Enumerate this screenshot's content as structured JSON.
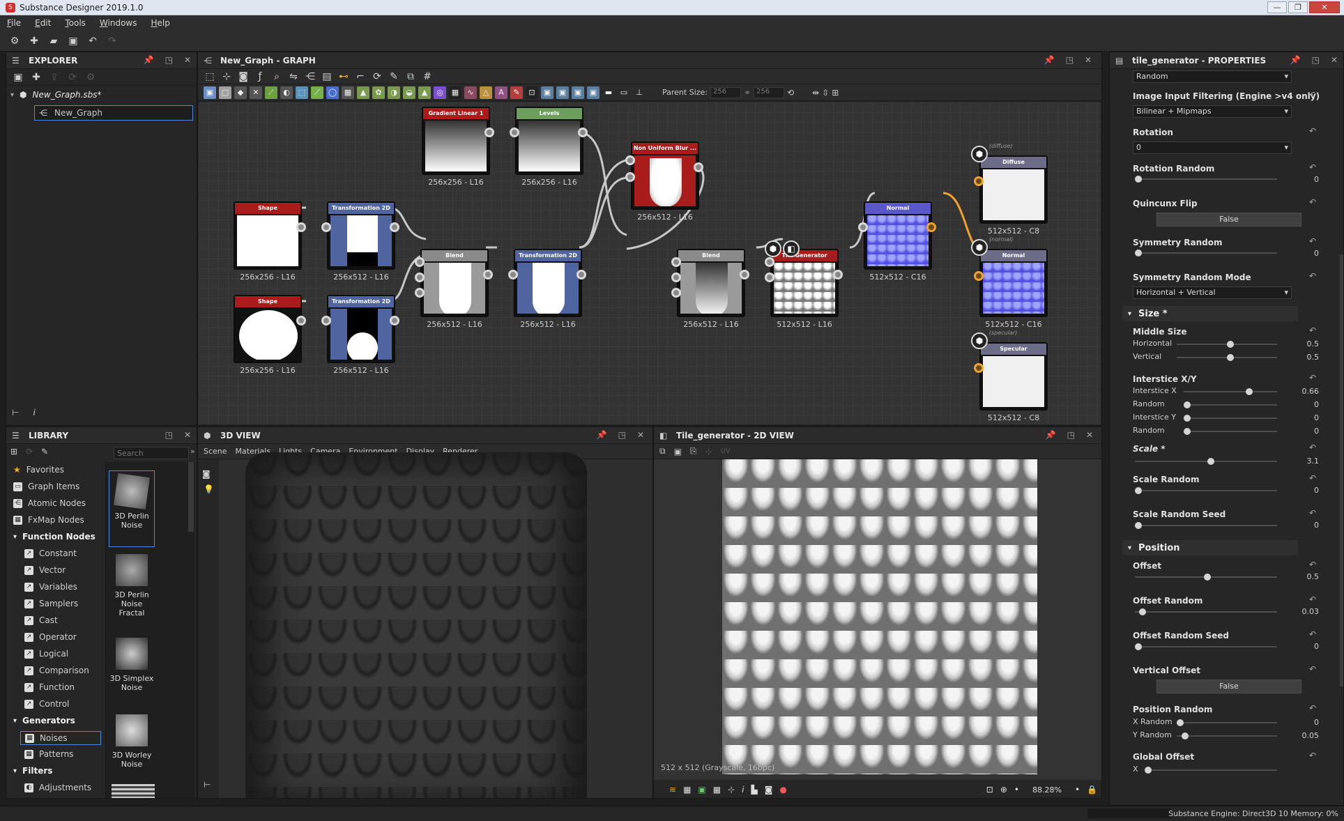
{
  "app": {
    "title": "Substance Designer 2019.1.0",
    "title_icon": "S"
  },
  "menu": [
    "File",
    "Edit",
    "Tools",
    "Windows",
    "Help"
  ],
  "explorer": {
    "title": "EXPLORER",
    "package": "New_Graph.sbs*",
    "graph": "New_Graph"
  },
  "graph_panel": {
    "title": "New_Graph - GRAPH",
    "parent_size_label": "Parent Size:",
    "parent_w": "256",
    "parent_h": "256"
  },
  "nodes": {
    "gradient": {
      "title": "Gradient Linear 1",
      "label": "256x256 - L16"
    },
    "levels": {
      "title": "Levels",
      "label": "256x256 - L16"
    },
    "nonuniform": {
      "title": "Non Uniform Blur ...",
      "label": "256x512 - L16"
    },
    "shape1": {
      "title": "Shape",
      "label": "256x256 - L16"
    },
    "transform1": {
      "title": "Transformation 2D",
      "label": "256x512 - L16"
    },
    "shape2": {
      "title": "Shape",
      "label": "256x256 - L16"
    },
    "transform2": {
      "title": "Transformation 2D",
      "label": "256x512 - L16"
    },
    "blend1": {
      "title": "Blend",
      "label": "256x512 - L16"
    },
    "transform3": {
      "title": "Transformation 2D",
      "label": "256x512 - L16"
    },
    "blend2": {
      "title": "Blend",
      "label": "256x512 - L16"
    },
    "tilegen": {
      "title": "Tile Generator",
      "label": "512x512 - L16"
    },
    "normal": {
      "title": "Normal",
      "label": "512x512 - C16"
    },
    "out_diffuse": {
      "title": "Diffuse",
      "tag": "(diffuse)",
      "label": "512x512 - C8"
    },
    "out_normal": {
      "title": "Normal",
      "tag": "(normal)",
      "label": "512x512 - C16"
    },
    "out_specular": {
      "title": "Specular",
      "tag": "(specular)",
      "label": "512x512 - C8"
    }
  },
  "library": {
    "title": "LIBRARY",
    "search_placeholder": "Search",
    "items": [
      "Favorites",
      "Graph Items",
      "Atomic Nodes",
      "FxMap Nodes"
    ],
    "function_header": "Function Nodes",
    "function_items": [
      "Constant",
      "Vector",
      "Variables",
      "Samplers",
      "Cast",
      "Operator",
      "Logical",
      "Comparison",
      "Function",
      "Control"
    ],
    "generators_header": "Generators",
    "generator_items": [
      "Noises",
      "Patterns"
    ],
    "filters_header": "Filters",
    "filter_items": [
      "Adjustments"
    ],
    "thumbs": [
      "3D Perlin Noise",
      "3D Perlin Noise Fractal",
      "3D Simplex Noise",
      "3D Worley Noise"
    ]
  },
  "view3d": {
    "title": "3D VIEW",
    "menu": [
      "Scene",
      "Materials",
      "Lights",
      "Camera",
      "Environment",
      "Display",
      "Renderer"
    ]
  },
  "view2d": {
    "title": "Tile_generator - 2D VIEW",
    "uv": "UV",
    "info": "512 x 512 (Grayscale, 16bpc)",
    "zoom": "88.28%"
  },
  "properties": {
    "title": "tile_generator - PROPERTIES",
    "random_dropdown": "Random",
    "filtering_label": "Image Input Filtering (Engine >v4 only)",
    "filtering_value": "Bilinear + Mipmaps",
    "rotation_label": "Rotation",
    "rotation_value": "0",
    "rotation_random_label": "Rotation Random",
    "rotation_random_val": "0",
    "quincunx_label": "Quincunx Flip",
    "quincunx_value": "False",
    "symrand_label": "Symmetry Random",
    "symrand_val": "0",
    "symmode_label": "Symmetry Random Mode",
    "symmode_value": "Horizontal + Vertical",
    "size_section": "Size *",
    "middle_size_label": "Middle Size",
    "horizontal": "Horizontal",
    "horizontal_val": "0.5",
    "vertical": "Vertical",
    "vertical_val": "0.5",
    "interstice_label": "Interstice X/Y",
    "interstice_x": "Interstice X",
    "interstice_x_val": "0.66",
    "random1": "Random",
    "random1_val": "0",
    "interstice_y": "Interstice Y",
    "interstice_y_val": "0",
    "random2": "Random",
    "random2_val": "0",
    "scale_label": "Scale *",
    "scale_val": "3.1",
    "scale_random_label": "Scale Random",
    "scale_random_val": "0",
    "scale_seed_label": "Scale Random Seed",
    "scale_seed_val": "0",
    "position_section": "Position",
    "offset_label": "Offset",
    "offset_val": "0.5",
    "offset_random_label": "Offset Random",
    "offset_random_val": "0.03",
    "offset_seed_label": "Offset Random Seed",
    "offset_seed_val": "0",
    "vertical_offset_label": "Vertical Offset",
    "vertical_offset_value": "False",
    "position_random_label": "Position Random",
    "x_random": "X Random",
    "x_random_val": "0",
    "y_random": "Y Random",
    "y_random_val": "0.05",
    "global_offset_label": "Global Offset",
    "x_label": "X"
  },
  "status": {
    "engine": "Substance Engine: Direct3D 10  Memory: 0%"
  }
}
